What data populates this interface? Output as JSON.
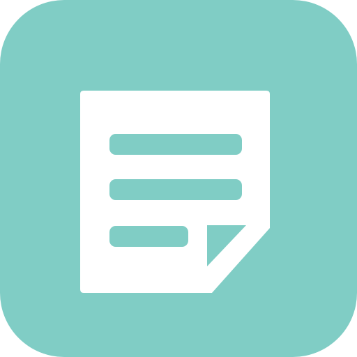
{
  "icon": {
    "name": "notes-app-icon",
    "glyph": "document-with-folded-corner",
    "colors": {
      "tile_background": "#80CDC5",
      "paper": "#FFFFFF",
      "text_lines": "#80CDC5",
      "folded_corner": "#80CDC5"
    }
  }
}
